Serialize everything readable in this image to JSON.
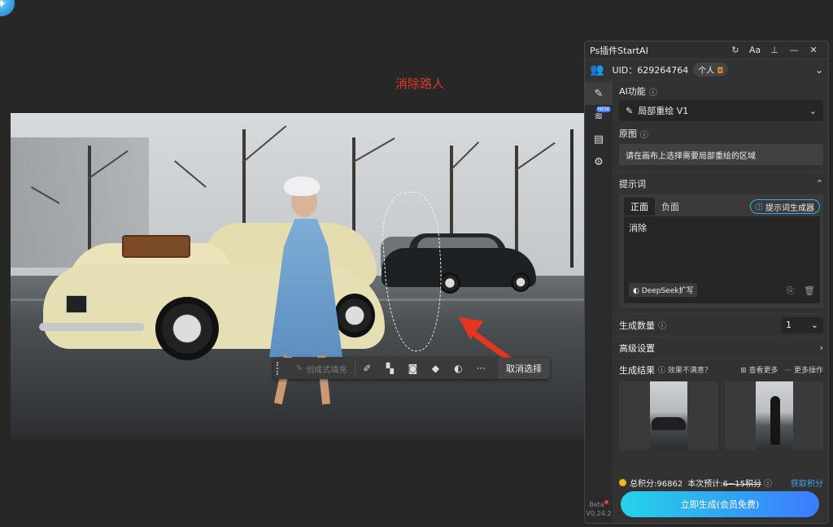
{
  "caption": "消除路人",
  "toolbar": {
    "generative_fill": "创成式填充",
    "cancel_selection": "取消选择",
    "more": "···"
  },
  "panel": {
    "title": "Ps插件StartAI",
    "uid": "UID：629264764",
    "account_tag": "个人",
    "ai_function_label": "AI功能",
    "ai_function_value": "局部重绘 V1",
    "original_label": "原图",
    "original_hint": "请在画布上选择需要局部重绘的区域",
    "prompt_label": "提示词",
    "tab_positive": "正面",
    "tab_negative": "负面",
    "prompt_generator": "提示词生成器",
    "prompt_text": "消除",
    "deepseek": "DeepSeek扩写",
    "quantity_label": "生成数量",
    "quantity_value": "1",
    "advanced_label": "高级设置",
    "results_label": "生成结果",
    "results_unhappy": "效果不满意？",
    "view_more": "查看更多",
    "more_actions": "更多操作",
    "points_total": "总积分:96862",
    "points_estimate_label": "本次预计:",
    "points_estimate_value": "6~15积分",
    "get_points": "获取积分",
    "generate_button": "立即生成(会员免费)",
    "beta": "Beta",
    "version": "V0.24.2"
  },
  "colors": {
    "accent": "#3da7e8",
    "arrow": "#e7361f",
    "caption": "#e0382c",
    "coin": "#f2b51f"
  }
}
